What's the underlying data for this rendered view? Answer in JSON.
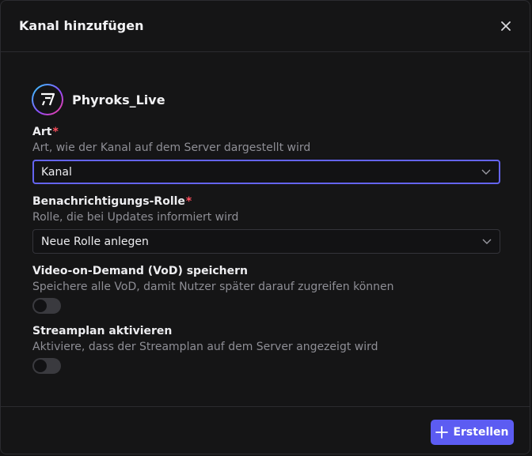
{
  "dialog": {
    "title": "Kanal hinzufügen",
    "close_icon": "close-icon"
  },
  "channel": {
    "name": "Phyroks_Live",
    "avatar_icon": "channel-avatar-icon"
  },
  "fields": {
    "art": {
      "label": "Art",
      "required_mark": "*",
      "description": "Art, wie der Kanal auf dem Server dargestellt wird",
      "selected": "Kanal"
    },
    "role": {
      "label": "Benachrichtigungs-Rolle",
      "required_mark": "*",
      "description": "Rolle, die bei Updates informiert wird",
      "selected": "Neue Rolle anlegen"
    },
    "vod": {
      "label": "Video-on-Demand (VoD) speichern",
      "description": "Speichere alle VoD, damit Nutzer später darauf zugreifen können",
      "enabled": false
    },
    "schedule": {
      "label": "Streamplan aktivieren",
      "description": "Aktiviere, dass der Streamplan auf dem Server angezeigt wird",
      "enabled": false
    }
  },
  "footer": {
    "create_label": "Erstellen",
    "plus_icon": "plus-icon"
  },
  "colors": {
    "accent": "#5c5cf2",
    "required": "#ff4f5e",
    "background": "#151516"
  }
}
